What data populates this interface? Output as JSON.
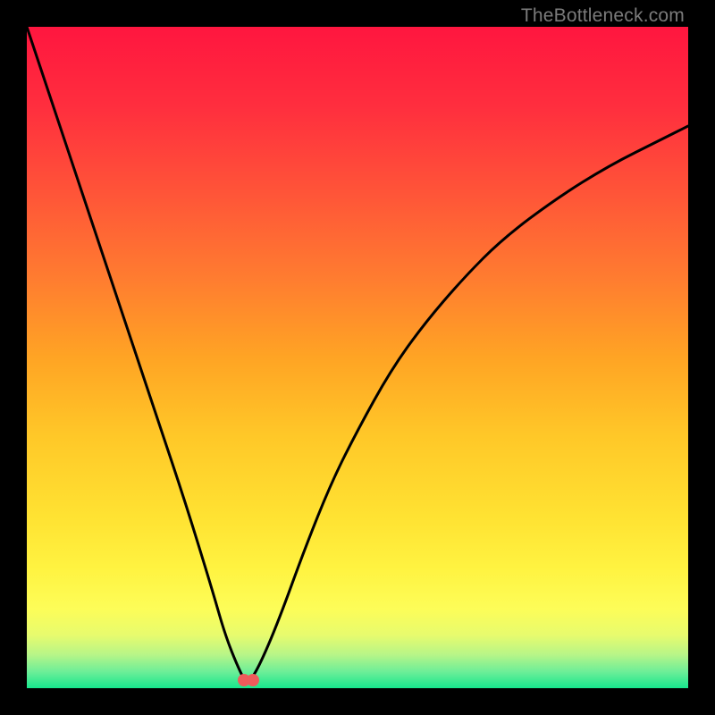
{
  "watermark": "TheBottleneck.com",
  "colors": {
    "frame": "#000000",
    "curve_stroke": "#000000",
    "watermark": "#7b7b7b",
    "marker": "#ef5b5b",
    "gradient_stops": [
      {
        "offset": 0.0,
        "color": "#ff163f"
      },
      {
        "offset": 0.12,
        "color": "#ff2e3e"
      },
      {
        "offset": 0.25,
        "color": "#ff5438"
      },
      {
        "offset": 0.38,
        "color": "#ff7c30"
      },
      {
        "offset": 0.5,
        "color": "#ffa424"
      },
      {
        "offset": 0.62,
        "color": "#ffc828"
      },
      {
        "offset": 0.74,
        "color": "#ffe232"
      },
      {
        "offset": 0.82,
        "color": "#fff341"
      },
      {
        "offset": 0.88,
        "color": "#fdfd58"
      },
      {
        "offset": 0.92,
        "color": "#e7fb6e"
      },
      {
        "offset": 0.95,
        "color": "#b6f588"
      },
      {
        "offset": 0.975,
        "color": "#6dee98"
      },
      {
        "offset": 1.0,
        "color": "#17e78d"
      }
    ]
  },
  "chart_data": {
    "type": "line",
    "title": "",
    "xlabel": "",
    "ylabel": "",
    "xlim": [
      0,
      100
    ],
    "ylim": [
      0,
      100
    ],
    "series": [
      {
        "name": "bottleneck-curve",
        "x": [
          0,
          4,
          8,
          12,
          16,
          20,
          24,
          28,
          30,
          32,
          33.3,
          35,
          38,
          42,
          46,
          50,
          55,
          60,
          66,
          72,
          80,
          88,
          96,
          100
        ],
        "y": [
          100,
          88,
          76,
          64,
          52,
          40,
          28,
          15,
          8,
          3,
          0.5,
          3,
          10,
          21,
          31,
          39,
          48,
          55,
          62,
          68,
          74,
          79,
          83,
          85
        ]
      }
    ],
    "annotations": [
      {
        "type": "marker",
        "x": 32.9,
        "y": 1.2,
        "name": "min-marker-left"
      },
      {
        "type": "marker",
        "x": 34.2,
        "y": 1.2,
        "name": "min-marker-right"
      }
    ],
    "description": "V-shaped bottleneck curve over a vertical red-to-green gradient. Minimum near x≈33."
  }
}
